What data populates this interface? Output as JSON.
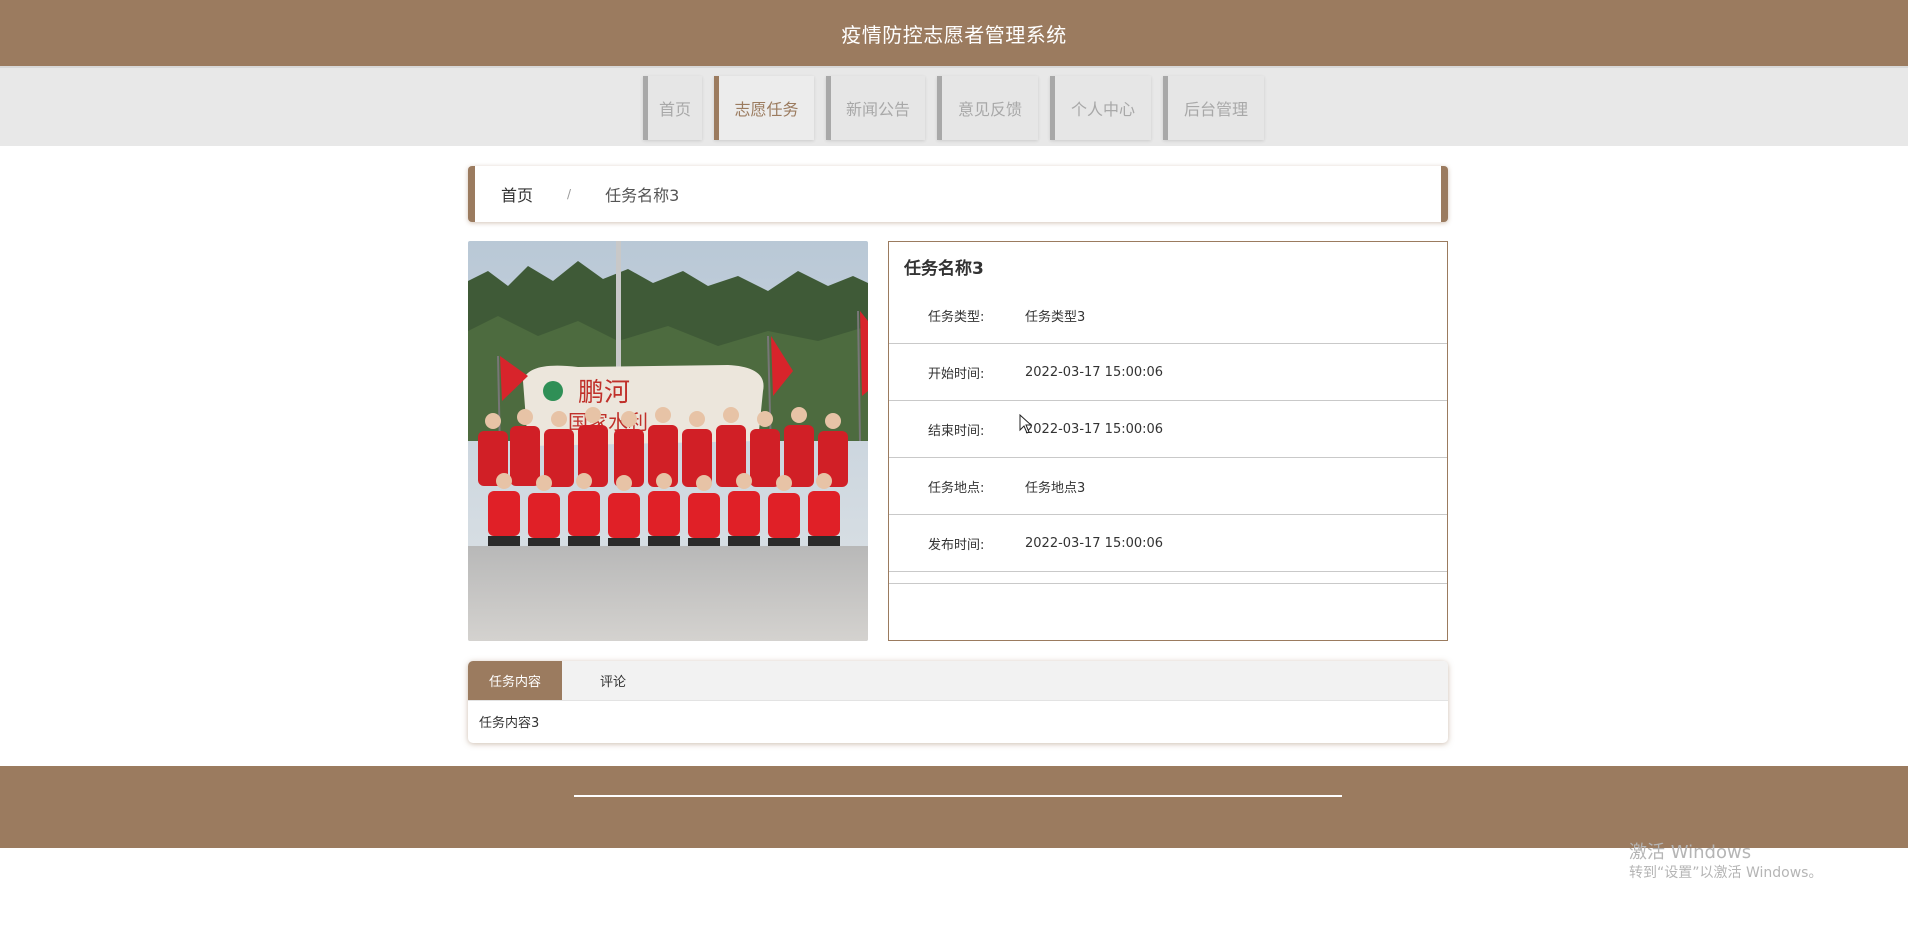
{
  "header": {
    "title": "疫情防控志愿者管理系统"
  },
  "nav": {
    "items": [
      {
        "label": "首页",
        "active": false
      },
      {
        "label": "志愿任务",
        "active": true
      },
      {
        "label": "新闻公告",
        "active": false
      },
      {
        "label": "意见反馈",
        "active": false
      },
      {
        "label": "个人中心",
        "active": false
      },
      {
        "label": "后台管理",
        "active": false
      }
    ]
  },
  "breadcrumb": {
    "home": "首页",
    "separator": "/",
    "current": "任务名称3"
  },
  "detail": {
    "title": "任务名称3",
    "rows": [
      {
        "label": "任务类型:",
        "value": "任务类型3"
      },
      {
        "label": "开始时间:",
        "value": "2022-03-17 15:00:06"
      },
      {
        "label": "结束时间:",
        "value": "2022-03-17 15:00:06"
      },
      {
        "label": "任务地点:",
        "value": "任务地点3"
      },
      {
        "label": "发布时间:",
        "value": "2022-03-17 15:00:06"
      }
    ]
  },
  "tabs": {
    "items": [
      {
        "label": "任务内容",
        "active": true
      },
      {
        "label": "评论",
        "active": false
      }
    ],
    "content": "任务内容3"
  },
  "watermark": {
    "line1": "激活 Windows",
    "line2": "转到“设置”以激活 Windows。"
  },
  "colors": {
    "brand": "#9b7b5f",
    "nav_bg": "#e8e8e8",
    "nav_inactive": "#a8a8a8"
  }
}
